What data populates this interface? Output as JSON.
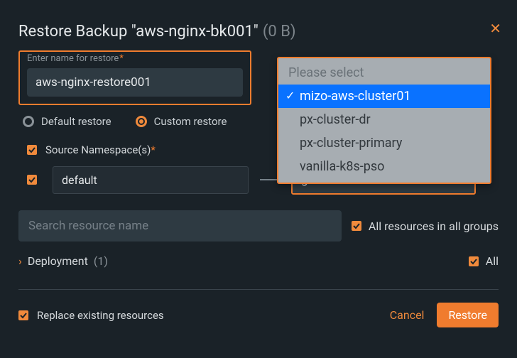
{
  "header": {
    "title_prefix": "Restore Backup ",
    "backup_name": "\"aws-nginx-bk001\"",
    "size": "(0 B)"
  },
  "name_field": {
    "label": "Enter name for restore",
    "value": "aws-nginx-restore001"
  },
  "restore_type": {
    "default_label": "Default restore",
    "custom_label": "Custom restore"
  },
  "source_ns": {
    "label": "Source Namespace(s)",
    "source_value": "default",
    "dest_value": "green"
  },
  "search": {
    "placeholder": "Search resource name",
    "all_label": "All resources in all groups"
  },
  "deployment": {
    "label": "Deployment",
    "count": "(1)",
    "all_label": "All"
  },
  "footer": {
    "replace_label": "Replace existing resources",
    "cancel": "Cancel",
    "restore": "Restore"
  },
  "dropdown": {
    "placeholder": "Please select",
    "options": [
      "mizo-aws-cluster01",
      "px-cluster-dr",
      "px-cluster-primary",
      "vanilla-k8s-pso"
    ],
    "selected_index": 0
  }
}
